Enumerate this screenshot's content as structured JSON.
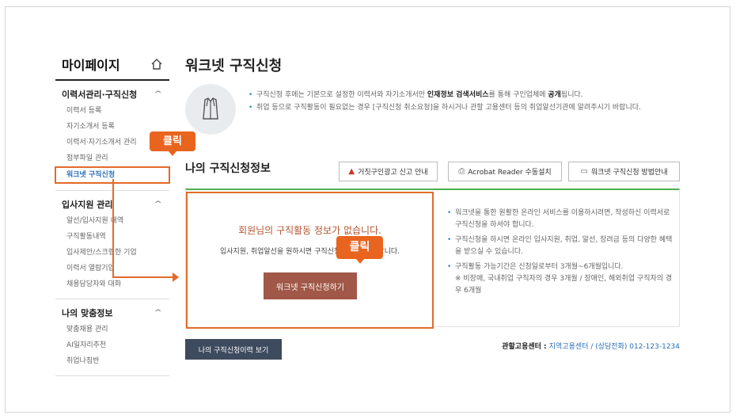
{
  "sidebar": {
    "title": "마이페이지",
    "home_icon": "home-icon",
    "groups": [
      {
        "label": "이력서관리·구직신청",
        "items": [
          "이력서 등록",
          "자기소개서 등록",
          "이력서·자기소개서 관리",
          "첨부파일 관리",
          "워크넷 구직신청"
        ]
      },
      {
        "label": "입사지원 관리",
        "items": [
          "알선/입사지원 내역",
          "구직활동내역",
          "입사제안/스크랩한 기업",
          "이력서 열람기업",
          "채용담당자와 대화"
        ]
      },
      {
        "label": "나의 맞춤정보",
        "items": [
          "맞춤채용 관리",
          "AI일자리추천",
          "취업나침반"
        ]
      }
    ]
  },
  "callouts": {
    "sidebar_click": "클릭",
    "panel_click": "클릭"
  },
  "main": {
    "title": "워크넷 구직신청",
    "notice": {
      "line1_pre": "구직신청 후에는 기본으로 설정한 이력서와 자기소개서만 ",
      "line1_bold": "인재정보 검색서비스",
      "line1_mid": "를 통해 구인업체에 ",
      "line1_bold2": "공개",
      "line1_post": "됩니다.",
      "line2": "취업 등으로 구직활동이 필요없는 경우 [구직신청 취소요청]을 하시거나 관할 고용센터 등의 취업알선기관에 알려주시기 바랍니다."
    },
    "section_title": "나의 구직신청정보",
    "buttons": {
      "fake_ad": "거짓구인광고 신고 안내",
      "acrobat": "Acrobat Reader 수동설치",
      "guide": "워크넷 구직신청 방법안내"
    },
    "empty": {
      "title": "회원님의 구직활동 정보가 없습니다.",
      "sub": "입사지원, 취업알선을 원하시면 구직신청을 하시기 바랍니다.",
      "apply_button": "워크넷 구직신청하기"
    },
    "info": [
      "워크넷을 통한 원활한 온라인 서비스를 이용하시려면, 작성하신 이력서로 구직신청을 하셔야 합니다.",
      "구직신청을 하시면 온라인 입사지원, 취업, 알선, 장려금 등의 다양한 혜택을 받으실 수 있습니다.",
      "구직활동 가능기간은 신청일로부터 3개월~6개월입니다."
    ],
    "info_note": "※ 비장애, 국내취업 구직자의 경우 3개월 / 장애인, 해외취업 구직자의 경우 6개월",
    "history_button": "나의 구직신청이력 보기",
    "center": {
      "label": "관할고용센터 : ",
      "name": "지역고용센터",
      "sep": " / ",
      "phone": "(상담전화) 012-123-1234"
    }
  },
  "colors": {
    "accent_orange": "#e46a2a",
    "apply_button": "#a15848",
    "history_button": "#3e4a5e",
    "link_blue": "#2a6fb8"
  }
}
